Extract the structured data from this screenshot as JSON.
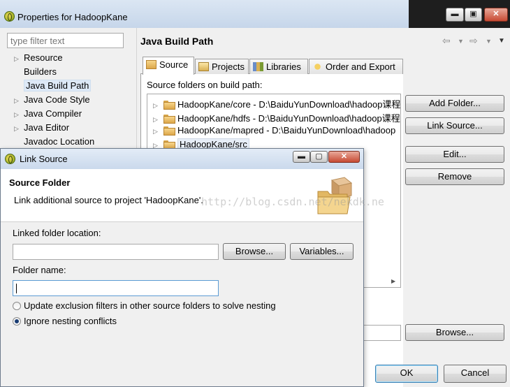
{
  "properties_window": {
    "title": "Properties for HadoopKane",
    "controls": {
      "minimize": "▬",
      "maximize": "▣",
      "close": "✕"
    },
    "filter_placeholder": "type filter text",
    "nav": [
      {
        "label": "Resource",
        "expandable": true
      },
      {
        "label": "Builders",
        "expandable": false
      },
      {
        "label": "Java Build Path",
        "expandable": false,
        "selected": true
      },
      {
        "label": "Java Code Style",
        "expandable": true
      },
      {
        "label": "Java Compiler",
        "expandable": true
      },
      {
        "label": "Java Editor",
        "expandable": true
      },
      {
        "label": "Javadoc Location",
        "expandable": false
      }
    ],
    "page_title": "Java Build Path",
    "tabs": [
      {
        "label": "Source",
        "active": true
      },
      {
        "label": "Projects"
      },
      {
        "label": "Libraries"
      },
      {
        "label": "Order and Export"
      }
    ],
    "source_label": "Source folders on build path:",
    "source_folders": [
      "HadoopKane/core - D:\\BaiduYunDownload\\hadoop课程",
      "HadoopKane/hdfs - D:\\BaiduYunDownload\\hadoop课程",
      "HadoopKane/mapred - D:\\BaiduYunDownload\\hadoop",
      "HadoopKane/src"
    ],
    "buttons": {
      "add_folder": "Add Folder...",
      "link_source": "Link Source...",
      "edit": "Edit...",
      "remove": "Remove",
      "browse": "Browse...",
      "ok": "OK",
      "cancel": "Cancel"
    }
  },
  "link_source_dialog": {
    "title": "Link Source",
    "controls": {
      "minimize": "▬",
      "maximize": "▢",
      "close": "✕"
    },
    "header_title": "Source Folder",
    "header_desc": "Link additional source to project 'HadoopKane'.",
    "linked_folder_label": "Linked folder location:",
    "linked_folder_value": "",
    "browse": "Browse...",
    "variables": "Variables...",
    "folder_name_label": "Folder name:",
    "folder_name_value": "",
    "options": [
      {
        "label": "Update exclusion filters in other source folders to solve nesting",
        "checked": false
      },
      {
        "label": "Ignore nesting conflicts",
        "checked": true
      }
    ]
  },
  "watermark": "http://blog.csdn.net/nekdk.ne",
  "colors": {
    "selection": "#dde9f7",
    "folder": "#dca74a",
    "title_bar": "#cad9ec"
  }
}
